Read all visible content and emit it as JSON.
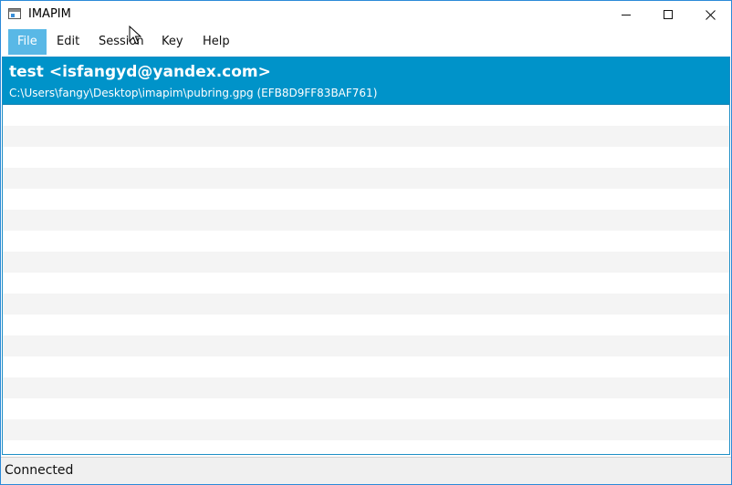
{
  "window": {
    "title": "IMAPIM",
    "app_icon": "window-app-icon",
    "controls": [
      "minimize-icon",
      "maximize-icon",
      "close-icon"
    ]
  },
  "menubar": {
    "items": [
      {
        "label": "File",
        "active": true
      },
      {
        "label": "Edit",
        "active": false
      },
      {
        "label": "Session",
        "active": false
      },
      {
        "label": "Key",
        "active": false
      },
      {
        "label": "Help",
        "active": false
      }
    ]
  },
  "keys": {
    "items": [
      {
        "name": "test <isfangyd@yandex.com>",
        "detail": "C:\\Users\\fangy\\Desktop\\imapim\\pubring.gpg (EFB8D9FF83BAF761)",
        "selected": true
      }
    ]
  },
  "status": {
    "text": "Connected"
  },
  "colors": {
    "selection": "#0093c9",
    "menu_active": "#59b8e6",
    "window_border": "#2b8ad8"
  }
}
